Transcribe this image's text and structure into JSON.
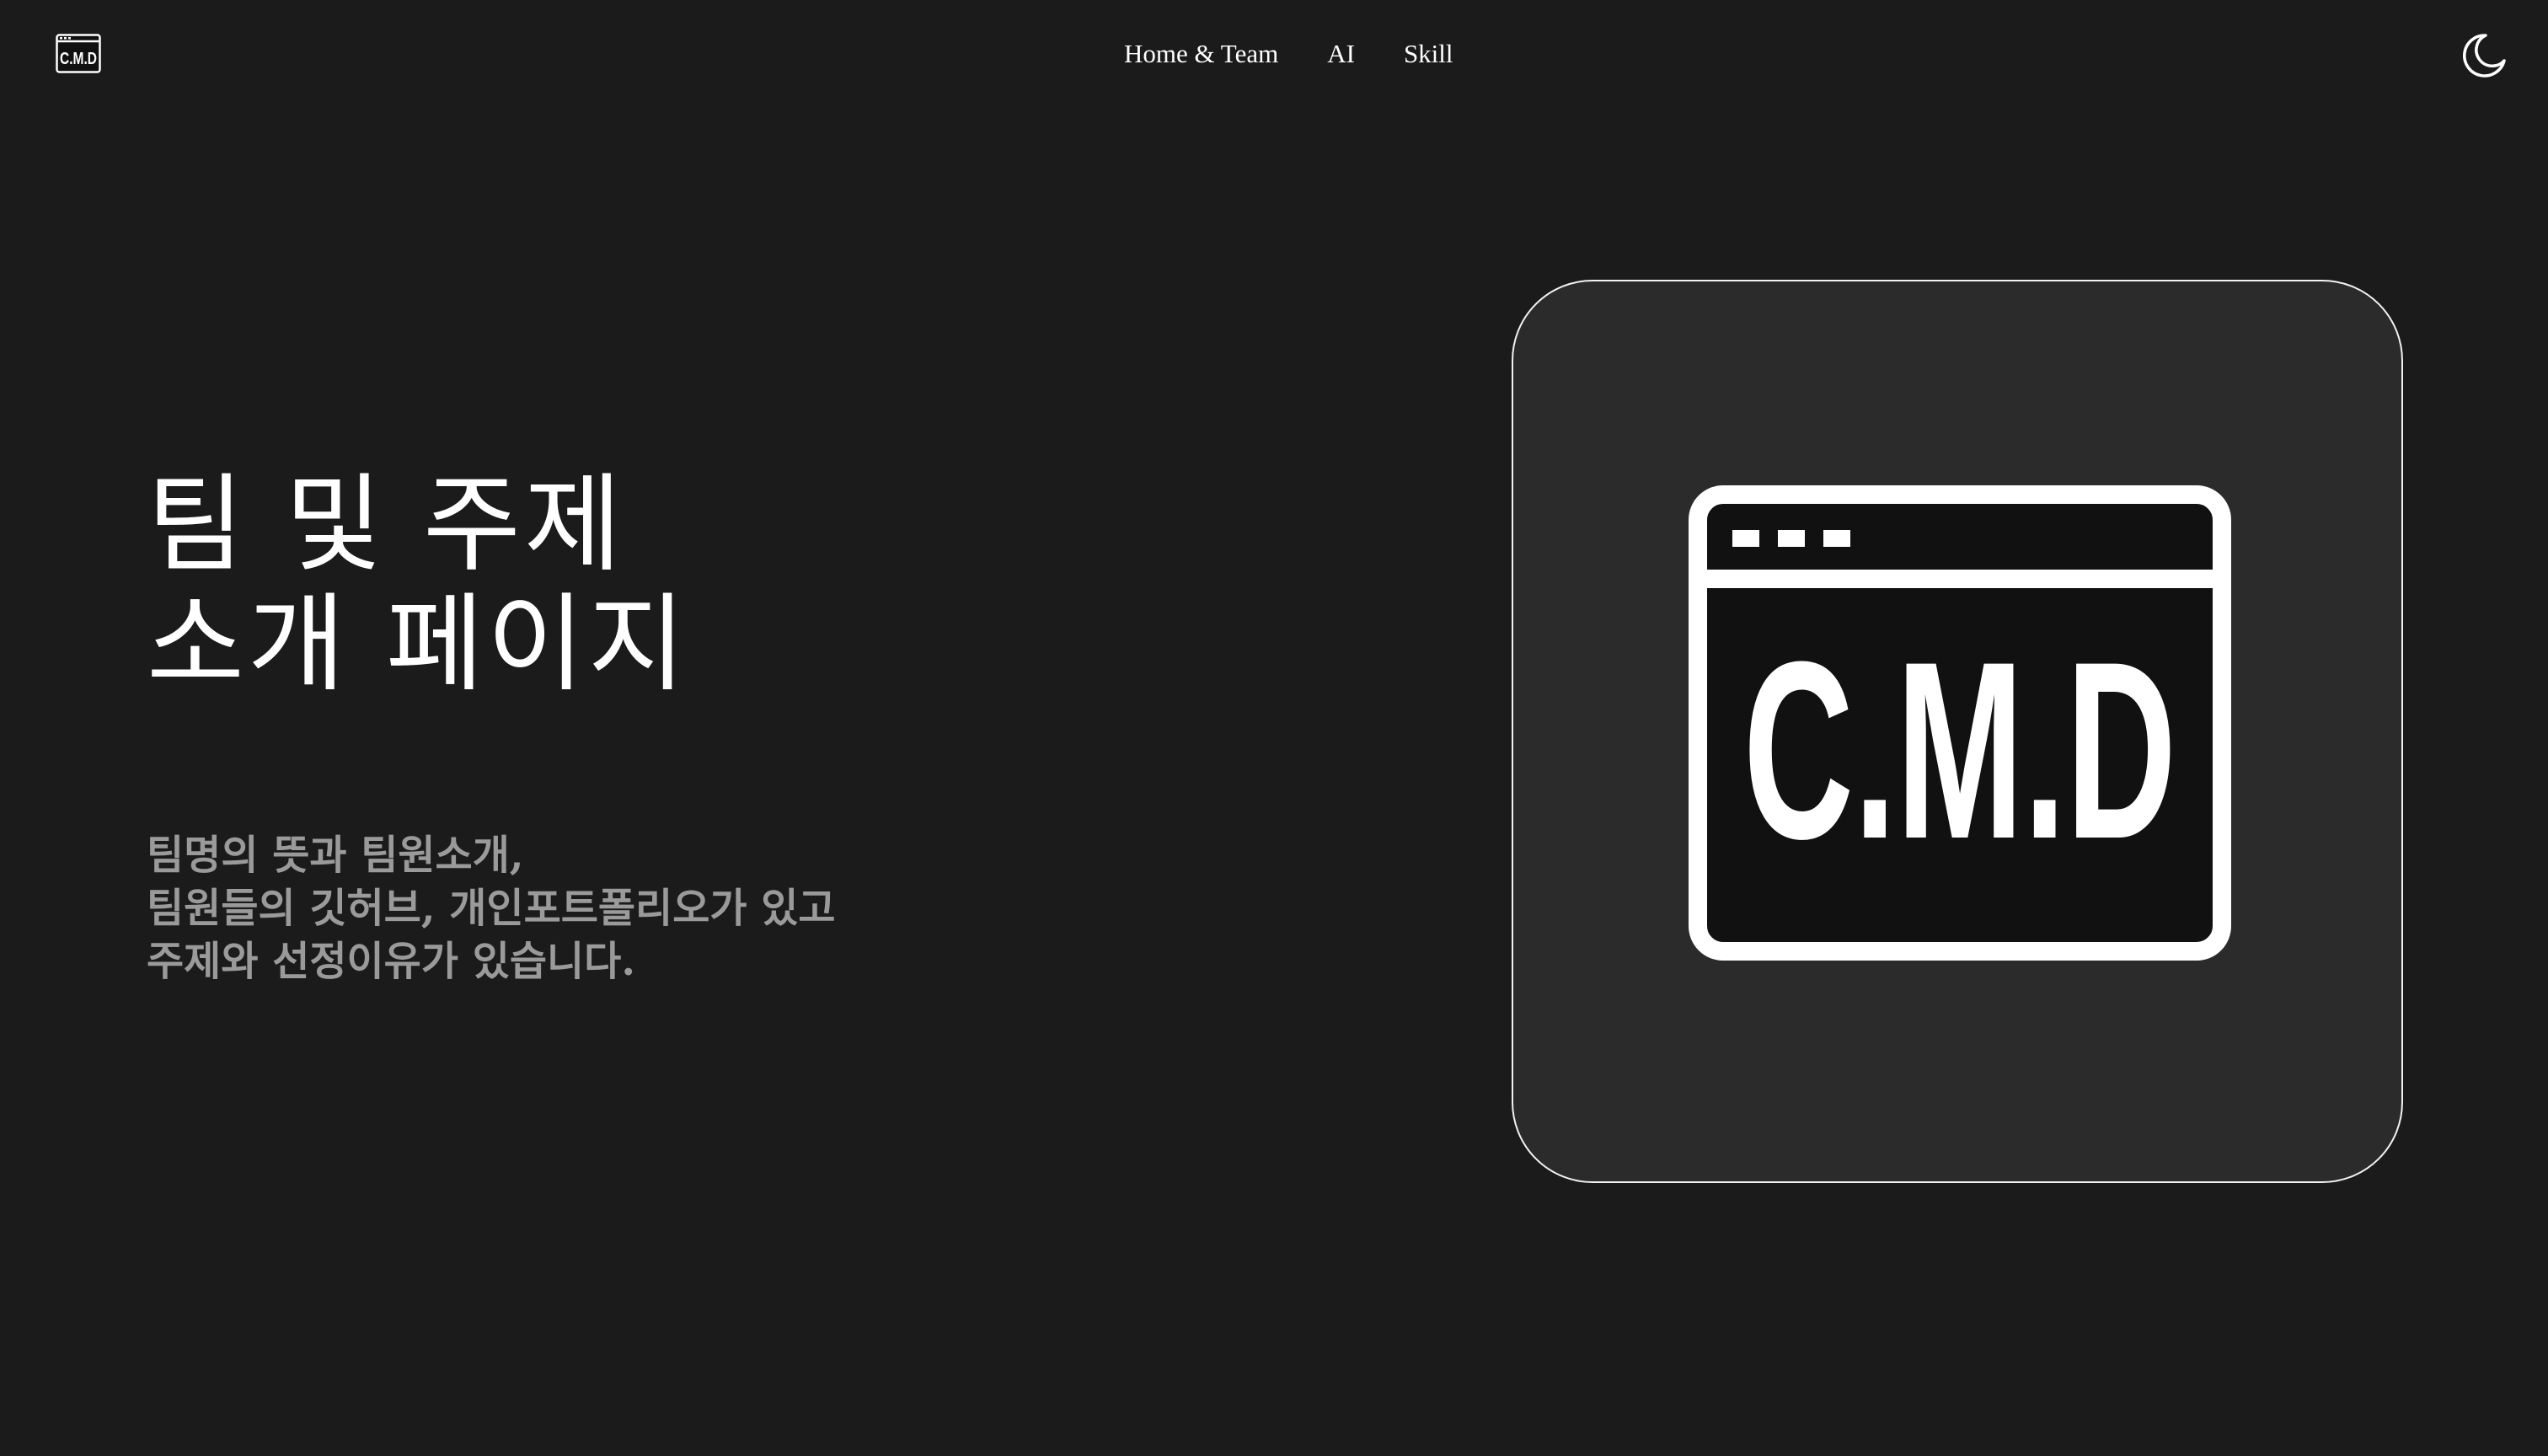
{
  "header": {
    "brand_text": "C.M.D",
    "brand_icon": "cmd-logo-icon",
    "nav": [
      {
        "label": "Home & Team"
      },
      {
        "label": "AI"
      },
      {
        "label": "Skill"
      }
    ],
    "theme_toggle_icon": "moon-icon"
  },
  "hero": {
    "title_lines": [
      "팀 및 주제",
      "소개 페이지"
    ],
    "description_lines": [
      "팀명의 뜻과 팀원소개,",
      "팀원들의 깃허브, 개인포트폴리오가 있고",
      "주제와 선정이유가 있습니다."
    ],
    "logo_text": "C.M.D"
  },
  "colors": {
    "background": "#1b1b1b",
    "card_background": "#2b2b2b",
    "text_primary": "#ffffff",
    "text_muted": "#9a9a9a",
    "logo_screen": "#111111"
  }
}
